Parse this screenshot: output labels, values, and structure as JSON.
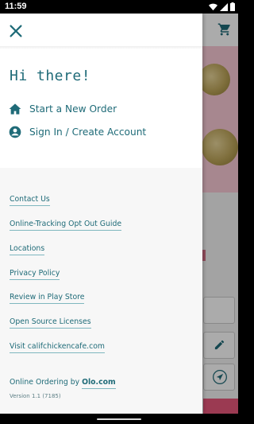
{
  "status_bar": {
    "time": "11:59"
  },
  "drawer": {
    "greeting": "Hi there!",
    "menu": [
      {
        "label": "Start a New Order",
        "icon": "home-icon"
      },
      {
        "label": "Sign In / Create Account",
        "icon": "account-circle-icon"
      }
    ],
    "links": [
      "Contact Us",
      "Online-Tracking Opt Out Guide",
      "Locations",
      "Privacy Policy",
      "Review in Play Store",
      "Open Source Licenses",
      "Visit califchickencafe.com"
    ],
    "footer": {
      "prefix": "Online Ordering by",
      "link": "Olo.com",
      "version": "Version 1.1 (7185)"
    }
  },
  "colors": {
    "accent": "#1f6b78",
    "underline": "#7fb7bf",
    "hero_pink": "#f9c9d6",
    "cta_pink": "#e7577b"
  }
}
